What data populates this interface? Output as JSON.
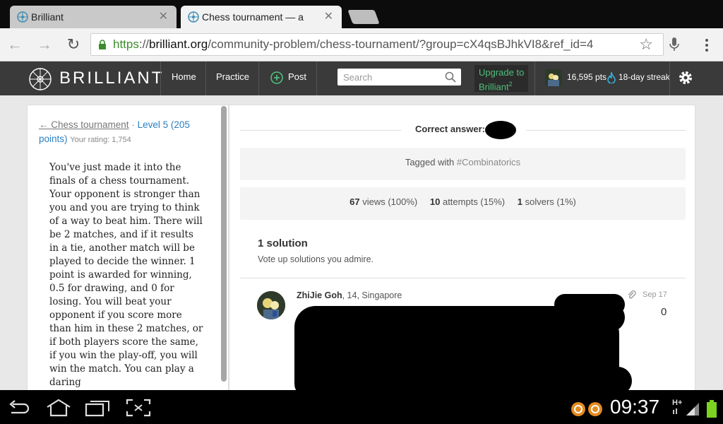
{
  "browser": {
    "tabs": [
      {
        "title": "Brilliant",
        "active": false
      },
      {
        "title": "Chess tournament — a",
        "active": true
      }
    ],
    "url": {
      "scheme": "https",
      "sep": "://",
      "domain": "brilliant.org",
      "path": "/community-problem/chess-tournament/?group=cX4qsBJhkVI8&ref_id=4"
    }
  },
  "site": {
    "logo_text": "BRILLIANT",
    "nav": {
      "home": "Home",
      "practice": "Practice",
      "post": "Post"
    },
    "search_placeholder": "Search",
    "upgrade_line1": "Upgrade to",
    "upgrade_line2": "Brilliant",
    "upgrade_sup": "2",
    "points": "16,595 pts",
    "streak": "18-day streak"
  },
  "problem": {
    "back_link": "← Chess tournament",
    "dot": " · ",
    "level": "Level 5 (205 points)",
    "rating": "Your rating: 1,754",
    "text": "You've just made it into the finals of a chess tournament. Your opponent is stronger than you and you are trying to think of a way to beat him. There will be 2 matches, and if it results in a tie, another match will be played to decide the winner. 1 point is awarded for winning, 0.5 for drawing, and 0 for losing. You will beat your opponent if you score more than him in these 2 matches, or if both players score the same, if you win the play-off, you will win the match. You can play a daring"
  },
  "answer": {
    "label": "Correct answer:"
  },
  "tags": {
    "prefix": "Tagged with",
    "tag": "#Combinatorics"
  },
  "stats": {
    "views_n": "67",
    "views_label": "views (100%)",
    "attempts_n": "10",
    "attempts_label": "attempts (15%)",
    "solvers_n": "1",
    "solvers_label": "solvers (1%)"
  },
  "solutions": {
    "title": "1 solution",
    "subtitle": "Vote up solutions you admire.",
    "items": [
      {
        "author": "ZhiJie Goh",
        "meta": ", 14, Singapore",
        "date": "Sep 17",
        "votes": "0"
      }
    ]
  },
  "system": {
    "clock": "09:37",
    "network": "H+"
  },
  "colors": {
    "header": "#3a3a3a",
    "link": "#2a7fc1",
    "upgrade": "#4fbf7c",
    "secure": "#3a8e2a"
  }
}
